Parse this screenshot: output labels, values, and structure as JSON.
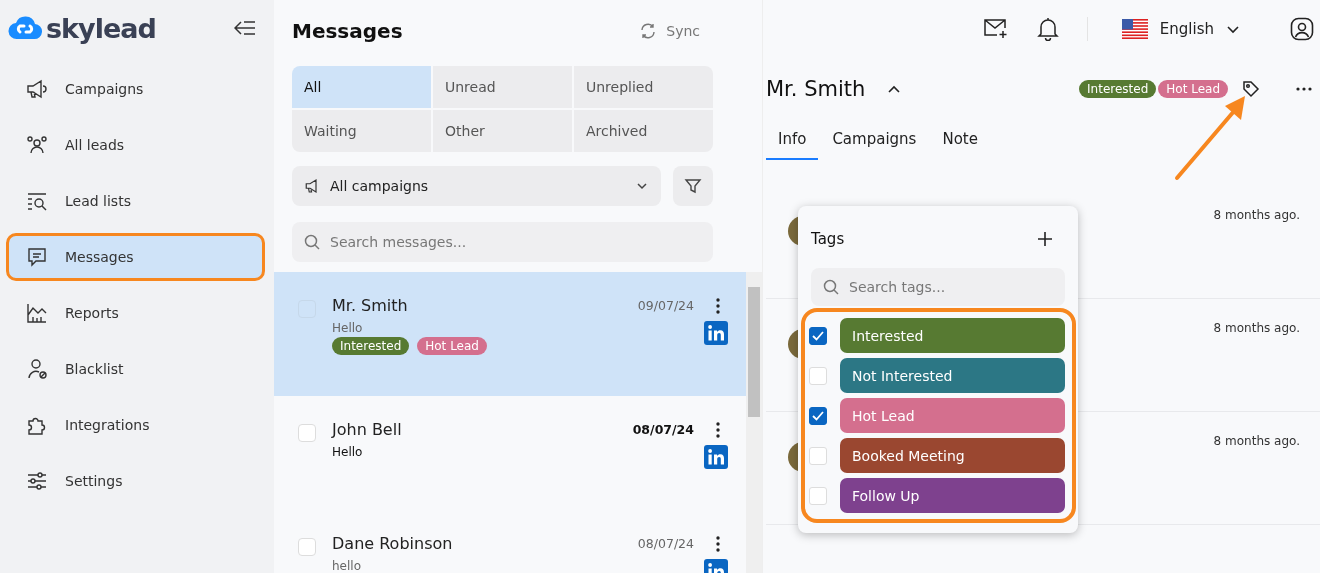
{
  "brand": {
    "name": "skylead"
  },
  "sidebar": {
    "items": [
      {
        "label": "Campaigns",
        "selected": false
      },
      {
        "label": "All leads",
        "selected": false
      },
      {
        "label": "Lead lists",
        "selected": false
      },
      {
        "label": "Messages",
        "selected": true
      },
      {
        "label": "Reports",
        "selected": false
      },
      {
        "label": "Blacklist",
        "selected": false
      },
      {
        "label": "Integrations",
        "selected": false
      },
      {
        "label": "Settings",
        "selected": false
      }
    ]
  },
  "messages": {
    "title": "Messages",
    "sync": "Sync",
    "filters": [
      {
        "label": "All",
        "selected": true
      },
      {
        "label": "Unread",
        "selected": false
      },
      {
        "label": "Unreplied",
        "selected": false
      },
      {
        "label": "Waiting",
        "selected": false
      },
      {
        "label": "Other",
        "selected": false
      },
      {
        "label": "Archived",
        "selected": false
      }
    ],
    "campaign_select": "All campaigns",
    "search": {
      "placeholder": "Search messages..."
    },
    "conversations": [
      {
        "name": "Mr. Smith",
        "preview": "Hello",
        "date": "09/07/24",
        "selected": true,
        "unread": false,
        "checked": false,
        "tags": [
          {
            "label": "Interested",
            "color": "#577a32"
          },
          {
            "label": "Hot Lead",
            "color": "#d46f8e"
          }
        ]
      },
      {
        "name": "John Bell",
        "preview": "Hello",
        "date": "08/07/24",
        "selected": false,
        "unread": true,
        "checked": false
      },
      {
        "name": "Dane Robinson",
        "preview": "hello",
        "date": "08/07/24",
        "selected": false,
        "unread": false,
        "checked": false
      }
    ]
  },
  "topbar": {
    "language": "English"
  },
  "lead": {
    "name": "Mr. Smith",
    "tags": [
      {
        "label": "Interested",
        "color": "#577a32"
      },
      {
        "label": "Hot Lead",
        "color": "#d46f8e"
      }
    ],
    "tabs": [
      {
        "label": "Info",
        "selected": true
      },
      {
        "label": "Campaigns",
        "selected": false
      },
      {
        "label": "Note",
        "selected": false
      }
    ],
    "activity": [
      {
        "time": "8 months ago."
      },
      {
        "time": "8 months ago."
      },
      {
        "time": "8 months ago."
      }
    ]
  },
  "tags_popup": {
    "title": "Tags",
    "search": {
      "placeholder": "Search tags..."
    },
    "tags": [
      {
        "label": "Interested",
        "color": "#577a32",
        "checked": true
      },
      {
        "label": "Not Interested",
        "color": "#2c7785",
        "checked": false
      },
      {
        "label": "Hot Lead",
        "color": "#d46f8e",
        "checked": true
      },
      {
        "label": "Booked Meeting",
        "color": "#9a4730",
        "checked": false
      },
      {
        "label": "Follow Up",
        "color": "#7e418e",
        "checked": false
      }
    ]
  }
}
